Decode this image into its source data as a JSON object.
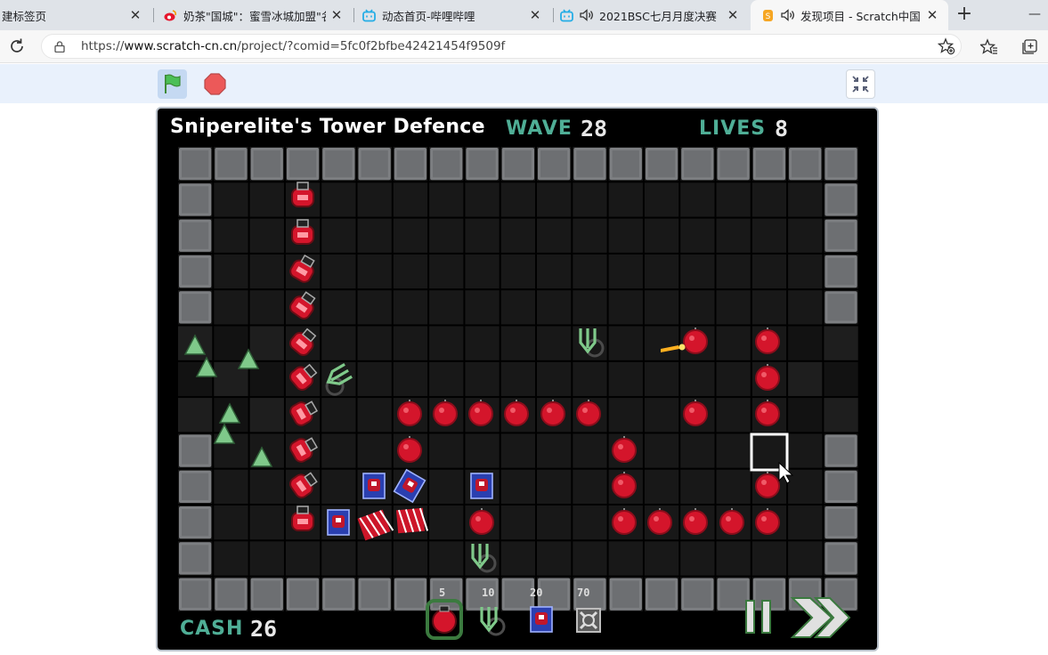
{
  "browser": {
    "tabs": [
      {
        "title": "建标签页",
        "active": false,
        "favicon": "none",
        "audio": false
      },
      {
        "title": "奶茶\"国城\"：蜜雪冰城加盟\"名",
        "active": false,
        "favicon": "weibo-icon",
        "audio": false
      },
      {
        "title": "动态首页-哔哩哔哩",
        "active": false,
        "favicon": "bilibili-icon",
        "audio": false
      },
      {
        "title": "2021BSC七月月度决赛「",
        "active": false,
        "favicon": "bilibili-icon",
        "audio": true
      },
      {
        "title": "发现项目 - Scratch中国",
        "active": true,
        "favicon": "scratch-cn-icon",
        "audio": true
      }
    ],
    "new_tab_label": "+",
    "minimize_label": "—",
    "url_host": "www.scratch-cn.cn",
    "url_prefix": "https://",
    "url_path": "/project/?comid=5fc0f2bfbe42421454f9509f"
  },
  "game": {
    "title": "Sniperelite's  Tower Defence",
    "wave_label": "WAVE",
    "wave_value": "28",
    "lives_label": "LIVES",
    "lives_value": "8",
    "cash_label": "CASH",
    "cash_value": "26",
    "shop": [
      {
        "price": "5",
        "tower": "red-bomb-tower"
      },
      {
        "price": "10",
        "tower": "green-arrow-tower"
      },
      {
        "price": "20",
        "tower": "blue-laser-tower"
      },
      {
        "price": "70",
        "tower": "grey-sniper-tower"
      }
    ],
    "colors": {
      "hud_label": "#4fae96",
      "wall": "#7d7f82",
      "path": "#0d0d0d",
      "floor": "#181818",
      "red_tower": "#d4152b",
      "green_unit": "#7fc98a",
      "blue_tower": "#2a3fb0"
    }
  }
}
